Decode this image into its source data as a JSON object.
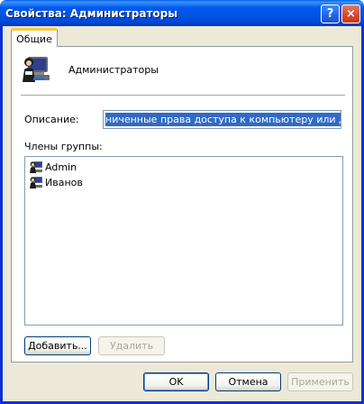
{
  "window": {
    "title": "Свойства: Администраторы"
  },
  "titlebar": {
    "help_glyph": "?",
    "close_glyph": "×"
  },
  "tabs": [
    {
      "label": "Общие",
      "selected": true
    }
  ],
  "general": {
    "group_name": "Администраторы",
    "description_label": "Описание:",
    "description_value": "ниченные права доступа к компьютеру или домену",
    "members_label": "Члены группы:",
    "members": [
      {
        "name": "Admin"
      },
      {
        "name": "Иванов"
      }
    ],
    "add_button": "Добавить...",
    "remove_button": "Удалить"
  },
  "footer": {
    "ok": "OK",
    "cancel": "Отмена",
    "apply": "Применить"
  },
  "colors": {
    "titlebar": "#0054e3",
    "selection": "#316ac5",
    "tab_accent": "#ffc83c",
    "dialog_bg": "#ece9d8"
  },
  "icons": {
    "group": "users-group-icon",
    "member": "user-icon"
  }
}
